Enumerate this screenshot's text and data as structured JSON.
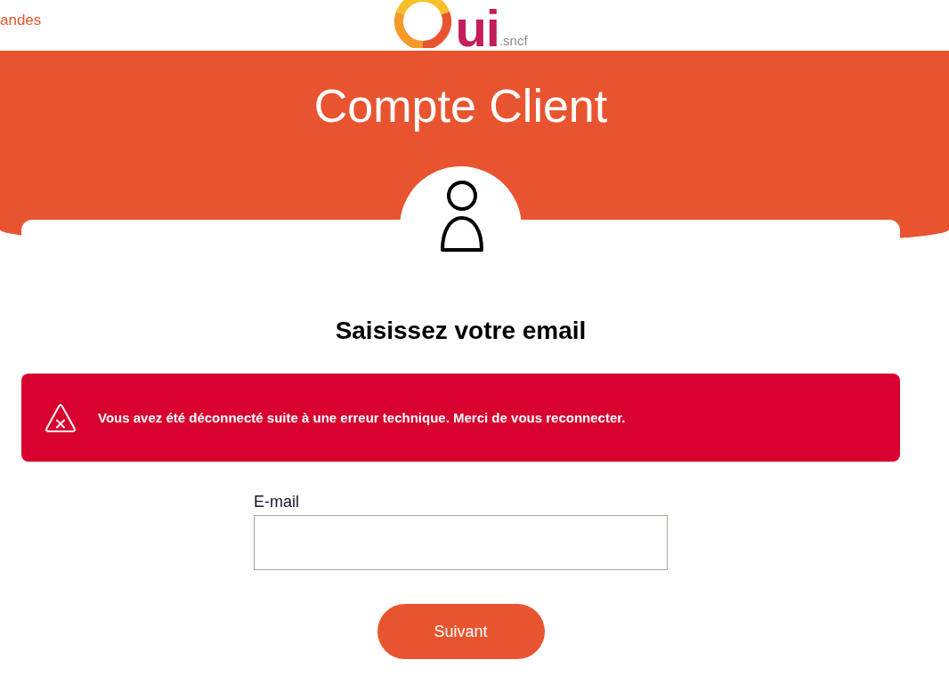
{
  "header": {
    "link": "andes",
    "logo": {
      "text": "ui",
      "suffix": ".sncf"
    }
  },
  "banner": {
    "title": "Compte Client"
  },
  "card": {
    "heading": "Saisissez votre email",
    "alert": {
      "kind": "error",
      "message": "Vous avez été déconnecté suite à une erreur technique. Merci de vous reconnecter."
    },
    "email_field": {
      "label": "E-mail"
    },
    "submit_button": "Suivant"
  }
}
